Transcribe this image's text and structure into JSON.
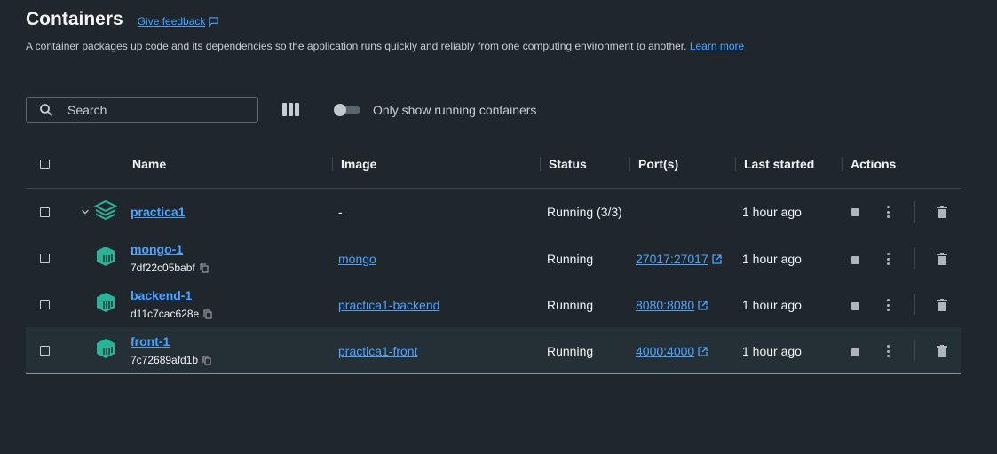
{
  "header": {
    "title": "Containers",
    "feedback_label": "Give feedback",
    "description": "A container packages up code and its dependencies so the application runs quickly and reliably from one computing environment to another.",
    "learn_more": "Learn more"
  },
  "toolbar": {
    "search_placeholder": "Search",
    "toggle_label": "Only show running containers",
    "toggle_on": false
  },
  "table": {
    "columns": [
      "Name",
      "Image",
      "Status",
      "Port(s)",
      "Last started",
      "Actions"
    ],
    "group": {
      "name": "practica1",
      "image": "-",
      "status": "Running (3/3)",
      "last_started": "1 hour ago"
    },
    "rows": [
      {
        "name": "mongo-1",
        "id": "7df22c05babf",
        "image": "mongo",
        "status": "Running",
        "port": "27017:27017",
        "last_started": "1 hour ago"
      },
      {
        "name": "backend-1",
        "id": "d11c7cac628e",
        "image": "practica1-backend",
        "status": "Running",
        "port": "8080:8080",
        "last_started": "1 hour ago"
      },
      {
        "name": "front-1",
        "id": "7c72689afd1b",
        "image": "practica1-front",
        "status": "Running",
        "port": "4000:4000",
        "last_started": "1 hour ago"
      }
    ]
  },
  "colors": {
    "background": "#1f272d",
    "link": "#4aa3ff",
    "container_icon": "#2bb39a"
  }
}
